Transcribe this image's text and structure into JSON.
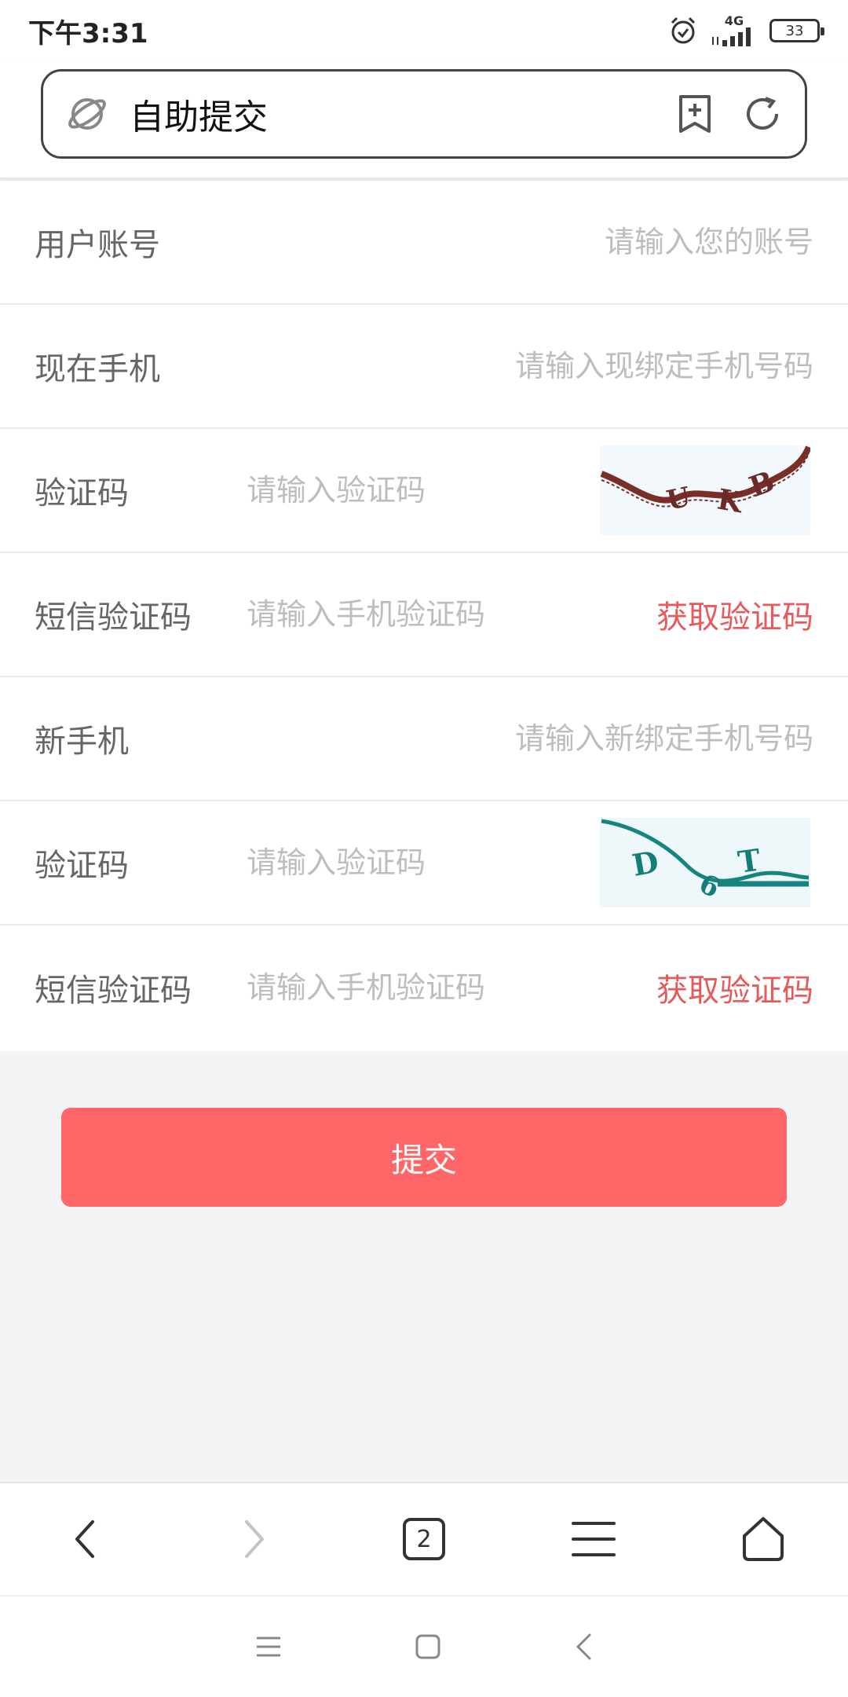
{
  "status_bar": {
    "time": "下午3:31",
    "network": "4G",
    "battery": "33"
  },
  "address_bar": {
    "title": "自助提交"
  },
  "form": {
    "rows": [
      {
        "label": "用户账号",
        "placeholder": "请输入您的账号"
      },
      {
        "label": "现在手机",
        "placeholder": "请输入现绑定手机号码"
      },
      {
        "label": "验证码",
        "placeholder": "请输入验证码"
      },
      {
        "label": "短信验证码",
        "placeholder": "请输入手机验证码",
        "action": "获取验证码"
      },
      {
        "label": "新手机",
        "placeholder": "请输入新绑定手机号码"
      },
      {
        "label": "验证码",
        "placeholder": "请输入验证码"
      },
      {
        "label": "短信验证码",
        "placeholder": "请输入手机验证码",
        "action": "获取验证码"
      }
    ]
  },
  "submit_label": "提交",
  "toolbar": {
    "tab_count": "2"
  },
  "colors": {
    "accent_red": "#ff6668",
    "link_red": "#e85a5a",
    "captcha1": "#7a2e28",
    "captcha2": "#17857f"
  }
}
